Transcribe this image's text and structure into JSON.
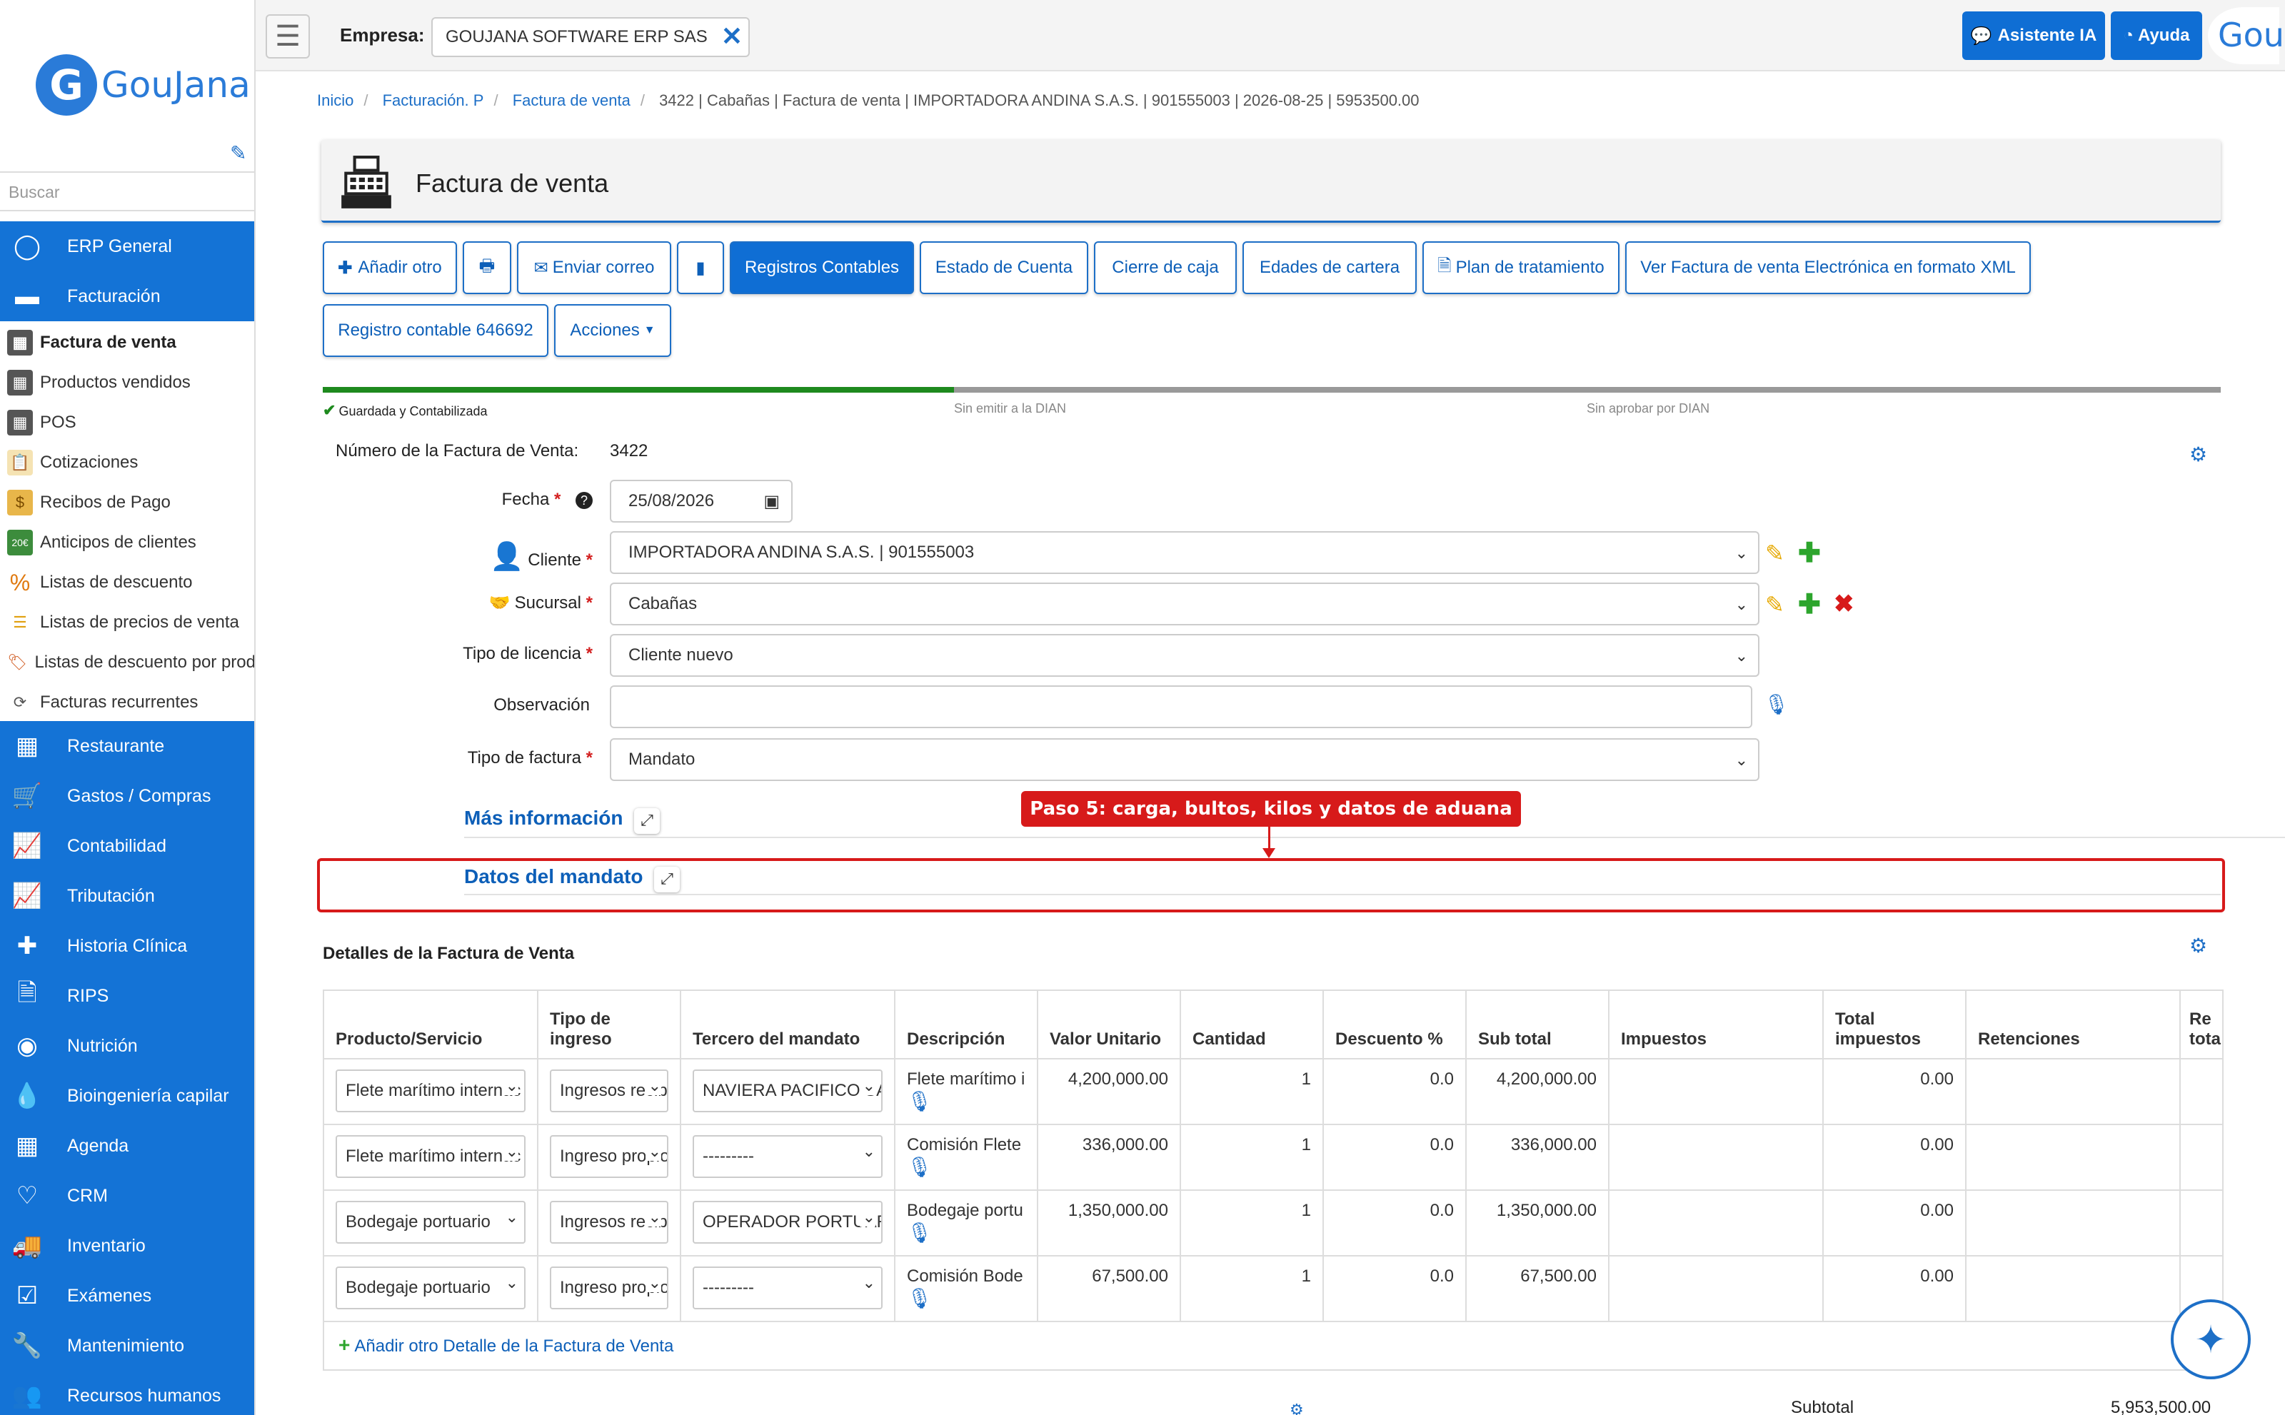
{
  "sidebar": {
    "logo_text": "GouJana",
    "search_placeholder": "Buscar",
    "top_items": [
      {
        "label": "ERP General"
      },
      {
        "label": "Facturación"
      }
    ],
    "sub_items": [
      {
        "label": "Factura de venta"
      },
      {
        "label": "Productos vendidos"
      },
      {
        "label": "POS"
      },
      {
        "label": "Cotizaciones"
      },
      {
        "label": "Recibos de Pago"
      },
      {
        "label": "Anticipos de clientes"
      },
      {
        "label": "Listas de descuento"
      },
      {
        "label": "Listas de precios de venta"
      },
      {
        "label": "Listas de descuento por prod"
      },
      {
        "label": "Facturas recurrentes"
      }
    ],
    "modules": [
      {
        "label": "Restaurante"
      },
      {
        "label": "Gastos / Compras"
      },
      {
        "label": "Contabilidad"
      },
      {
        "label": "Tributación"
      },
      {
        "label": "Historia Clínica"
      },
      {
        "label": "RIPS"
      },
      {
        "label": "Nutrición"
      },
      {
        "label": "Bioingeniería capilar"
      },
      {
        "label": "Agenda"
      },
      {
        "label": "CRM"
      },
      {
        "label": "Inventario"
      },
      {
        "label": "Exámenes"
      },
      {
        "label": "Mantenimiento"
      },
      {
        "label": "Recursos humanos"
      }
    ]
  },
  "topbar": {
    "empresa_label": "Empresa:",
    "empresa_value": "GOUJANA SOFTWARE ERP SAS",
    "asistente_label": "Asistente IA",
    "ayuda_label": "Ayuda",
    "corner_text": "Gou"
  },
  "breadcrumb": {
    "items": [
      "Inicio",
      "Facturación. P",
      "Factura de venta"
    ],
    "current": "3422 | Cabañas | Factura de venta | IMPORTADORA ANDINA S.A.S. | 901555003 | 2026-08-25 | 5953500.00"
  },
  "page_title": "Factura de venta",
  "actions": {
    "add_other": "Añadir otro",
    "send_mail": "Enviar correo",
    "registros": "Registros Contables",
    "estado": "Estado de Cuenta",
    "cierre": "Cierre de caja",
    "edades": "Edades de cartera",
    "plan": "Plan de tratamiento",
    "xml": "Ver Factura de venta Electrónica en formato XML",
    "registro_contable": "Registro contable 646692",
    "acciones": "Acciones"
  },
  "progress": {
    "steps": [
      "Guardada y Contabilizada",
      "Sin emitir a la DIAN",
      "Sin aprobar por DIAN"
    ],
    "completed": 1,
    "colors": {
      "done": "#1e8a1e",
      "pending": "#999999"
    }
  },
  "form": {
    "numero_label": "Número de la Factura de Venta:",
    "numero_value": "3422",
    "fecha_label": "Fecha",
    "fecha_value": "25/08/2026",
    "cliente_label": "Cliente",
    "cliente_value": "IMPORTADORA ANDINA S.A.S. | 901555003",
    "sucursal_label": "Sucursal",
    "sucursal_value": "Cabañas",
    "licencia_label": "Tipo de licencia",
    "licencia_value": "Cliente nuevo",
    "observacion_label": "Observación",
    "observacion_value": "",
    "tipo_factura_label": "Tipo de factura",
    "tipo_factura_value": "Mandato"
  },
  "sections": {
    "mas_info": "Más información",
    "mandato": "Datos del mandato",
    "callout": "Paso 5: carga, bultos, kilos y datos de aduana"
  },
  "details": {
    "title": "Detalles de la Factura de Venta",
    "headers": [
      "Producto/Servicio",
      "Tipo de ingreso",
      "Tercero del mandato",
      "Descripción",
      "Valor Unitario",
      "Cantidad",
      "Descuento %",
      "Sub total",
      "Impuestos",
      "Total impuestos",
      "Retenciones",
      "Re tota"
    ],
    "rows": [
      {
        "producto": "Flete marítimo internac",
        "tipo": "Ingresos recib",
        "tercero": "NAVIERA PACIFICO SA",
        "descripcion": "Flete marítimo i",
        "valor": "4,200,000.00",
        "cantidad": "1",
        "descuento": "0.0",
        "subtotal": "4,200,000.00",
        "total_impuestos": "0.00"
      },
      {
        "producto": "Flete marítimo internac",
        "tipo": "Ingreso propio",
        "tercero": "---------",
        "descripcion": "Comisión Flete",
        "valor": "336,000.00",
        "cantidad": "1",
        "descuento": "0.0",
        "subtotal": "336,000.00",
        "total_impuestos": "0.00"
      },
      {
        "producto": "Bodegaje portuario",
        "tipo": "Ingresos recib",
        "tercero": "OPERADOR PORTUAR",
        "descripcion": "Bodegaje portu",
        "valor": "1,350,000.00",
        "cantidad": "1",
        "descuento": "0.0",
        "subtotal": "1,350,000.00",
        "total_impuestos": "0.00"
      },
      {
        "producto": "Bodegaje portuario",
        "tipo": "Ingreso propio",
        "tercero": "---------",
        "descripcion": "Comisión Bode",
        "valor": "67,500.00",
        "cantidad": "1",
        "descuento": "0.0",
        "subtotal": "67,500.00",
        "total_impuestos": "0.00"
      }
    ],
    "add_label": "Añadir otro Detalle de la Factura de Venta",
    "subtotal_label": "Subtotal",
    "subtotal_value": "5,953,500.00"
  },
  "colors": {
    "primary": "#0f6ed4",
    "sidebar": "#1473d6",
    "alert": "#d71a1a",
    "success": "#2da52d"
  }
}
